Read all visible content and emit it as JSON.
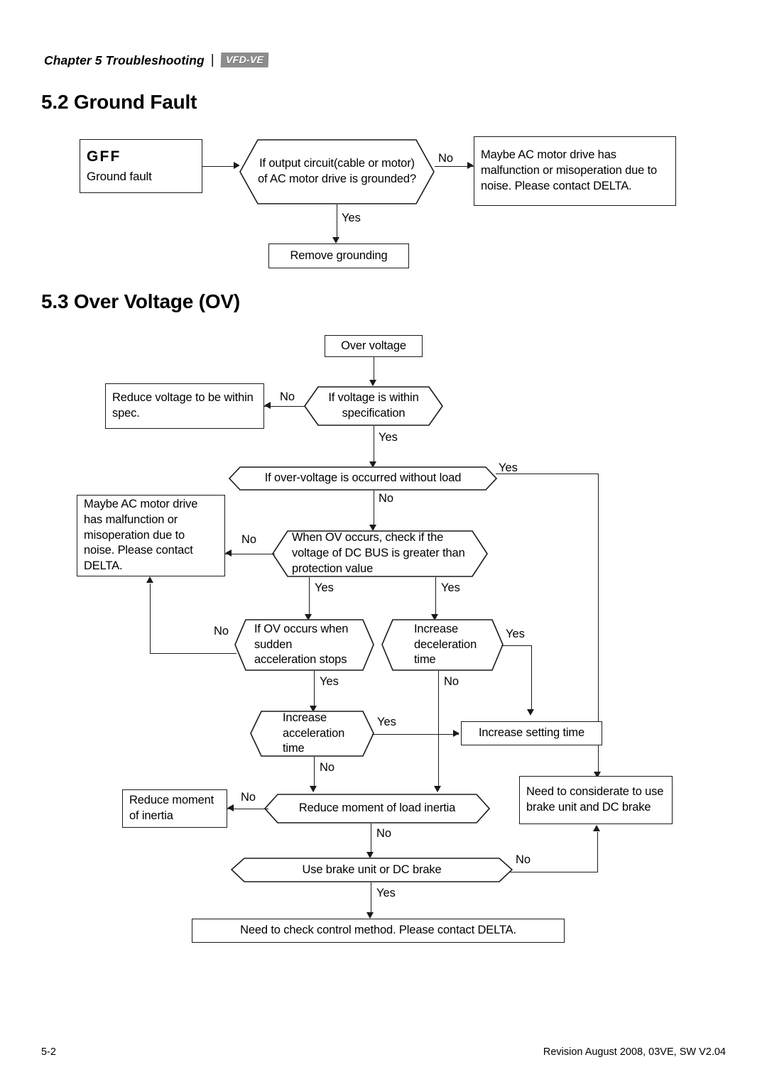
{
  "header": {
    "chapter": "Chapter 5  Troubleshooting",
    "separator": "|",
    "logo": "VFD-VE"
  },
  "sections": [
    {
      "id": "5.2",
      "title": "5.2 Ground Fault"
    },
    {
      "id": "5.3",
      "title": "5.3 Over Voltage (OV)"
    }
  ],
  "footer": {
    "page": "5-2",
    "revision": "Revision August 2008, 03VE, SW V2.04"
  },
  "ground_fault_flow": {
    "start": {
      "code": "GFF",
      "label": "Ground fault"
    },
    "decision": "If output circuit(cable or motor) of AC motor drive is grounded?",
    "no_label": "No",
    "yes_label": "Yes",
    "no_result": "Maybe AC motor drive  has malfunction or misoperation due to noise. Please contact DELTA.",
    "yes_result": "Remove grounding"
  },
  "over_voltage_flow": {
    "start": "Over voltage",
    "d1": "If voltage is within specification",
    "d1_no": "No",
    "d1_no_result": "Reduce voltage to be within spec.",
    "d1_yes": "Yes",
    "d2": "If over-voltage is occurred without load",
    "d2_yes": "Yes",
    "d2_no": "No",
    "d3": "When OV occurs, check if the voltage of DC BUS is greater than protection value",
    "d3_no": "No",
    "d3_no_result": "Maybe AC motor drive has malfunction or misoperation due to noise. Please contact DELTA.",
    "d3_yes_left": "Yes",
    "d3_yes_right": "Yes",
    "d4": "If OV occurs when sudden acceleration stops",
    "d4_no": "No",
    "d4_yes": "Yes",
    "d5": "Increase deceleration time",
    "d5_yes": "Yes",
    "d5_no": "No",
    "d6": "Increase acceleration time",
    "d6_yes": "Yes",
    "d6_no": "No",
    "setting_time": "Increase setting time",
    "brake_consider": "Need to considerate to use brake unit  and DC brake",
    "d7": "Reduce moment of load  inertia",
    "d7_no_left": "No",
    "d7_no_down": "No",
    "reduce_inertia": "Reduce moment of inertia",
    "d8": "Use brake unit or DC brake",
    "d8_no": "No",
    "d8_yes": "Yes",
    "final": "Need to check control method. Please contact DELTA."
  }
}
